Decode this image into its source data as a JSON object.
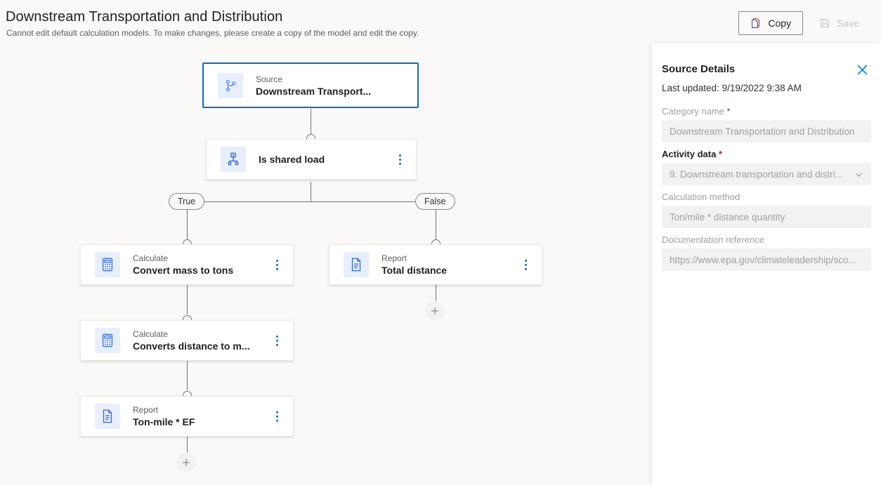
{
  "header": {
    "title": "Downstream Transportation and Distribution",
    "subtitle": "Cannot edit default calculation models. To make changes, please create a copy of the model and edit the copy.",
    "buttons": {
      "copy": {
        "label": "Copy",
        "icon": "copy-icon",
        "disabled": false
      },
      "save": {
        "label": "Save",
        "icon": "save-icon",
        "disabled": true
      }
    }
  },
  "canvas": {
    "nodes": [
      {
        "id": "source",
        "kind": "Source",
        "name": "Downstream Transport...",
        "icon": "branch-source-icon",
        "selected": true,
        "has_menu": false
      },
      {
        "id": "condition",
        "kind": "",
        "name": "Is shared load",
        "icon": "decision-icon",
        "selected": false,
        "has_menu": true
      },
      {
        "id": "calc1",
        "kind": "Calculate",
        "name": "Convert mass to tons",
        "icon": "calculator-icon",
        "selected": false,
        "has_menu": true
      },
      {
        "id": "report1",
        "kind": "Report",
        "name": "Total distance",
        "icon": "document-icon",
        "selected": false,
        "has_menu": true
      },
      {
        "id": "calc2",
        "kind": "Calculate",
        "name": "Converts distance to m...",
        "icon": "calculator-icon",
        "selected": false,
        "has_menu": true
      },
      {
        "id": "report2",
        "kind": "Report",
        "name": "Ton-mile * EF",
        "icon": "document-icon",
        "selected": false,
        "has_menu": true
      }
    ],
    "branch_labels": {
      "true": "True",
      "false": "False"
    },
    "add_buttons": {
      "label": "+",
      "name": "add-step-button"
    }
  },
  "panel": {
    "title": "Source Details",
    "close_icon": "close-icon",
    "last_updated": "Last updated: 9/19/2022 9:38 AM",
    "fields": [
      {
        "id": "category-name",
        "label": "Category name",
        "required": true,
        "label_muted": true,
        "value": "Downstream Transportation and Distribution",
        "type": "text"
      },
      {
        "id": "activity-data",
        "label": "Activity data",
        "required": true,
        "label_muted": false,
        "value": "9. Downstream transportation and distri...",
        "type": "dropdown"
      },
      {
        "id": "calc-method",
        "label": "Calculation method",
        "required": false,
        "label_muted": true,
        "value": "Ton/mile * distance quantity",
        "type": "text"
      },
      {
        "id": "doc-reference",
        "label": "Documentation reference",
        "required": false,
        "label_muted": true,
        "value": "https://www.epa.gov/climateleadership/sco...",
        "type": "text"
      }
    ]
  },
  "colors": {
    "accent": "#0f6cbd",
    "close_x": "#0f83d9",
    "required": "#a4262c",
    "canvas_bg": "#faf9f8",
    "icon_bg": "#e8eefc"
  }
}
